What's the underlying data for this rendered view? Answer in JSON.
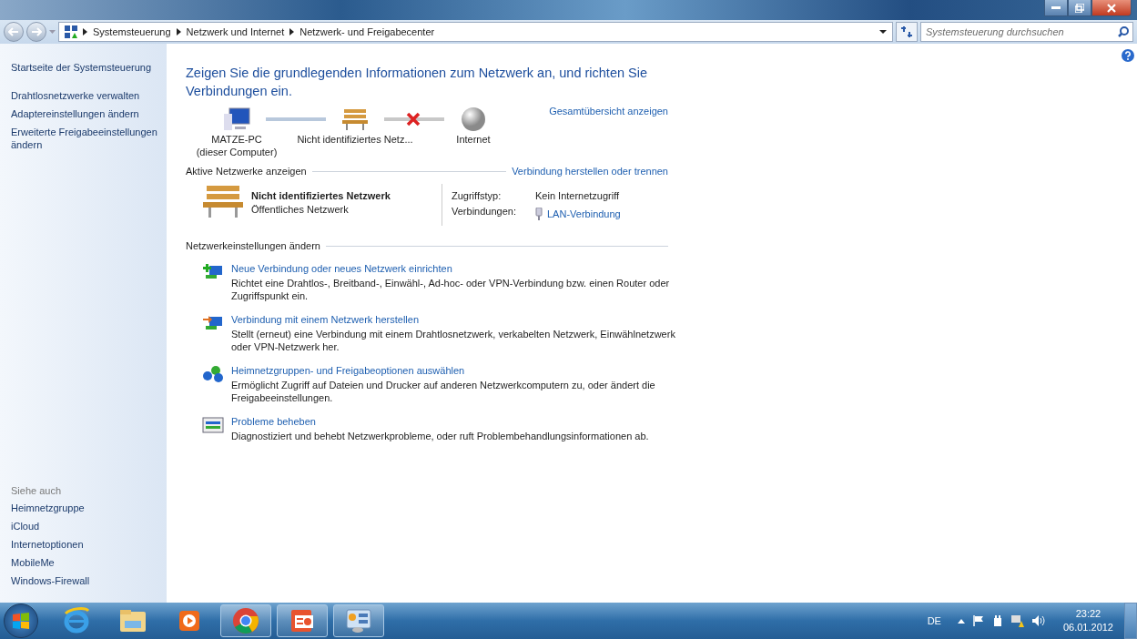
{
  "address_bar": {
    "crumbs": [
      "Systemsteuerung",
      "Netzwerk und Internet",
      "Netzwerk- und Freigabecenter"
    ]
  },
  "search": {
    "placeholder": "Systemsteuerung durchsuchen"
  },
  "sidebar": {
    "home": "Startseite der Systemsteuerung",
    "tasks": [
      "Drahtlosnetzwerke verwalten",
      "Adaptereinstellungen ändern",
      "Erweiterte Freigabeeinstellungen ändern"
    ],
    "see_also_title": "Siehe auch",
    "see_also": [
      "Heimnetzgruppe",
      "iCloud",
      "Internetoptionen",
      "MobileMe",
      "Windows-Firewall"
    ]
  },
  "heading": "Zeigen Sie die grundlegenden Informationen zum Netzwerk an, und richten Sie Verbindungen ein.",
  "map": {
    "nodes": [
      {
        "kind": "computer",
        "label": "MATZE-PC",
        "sublabel": "(dieser Computer)"
      },
      {
        "kind": "bench",
        "label": "Nicht identifiziertes Netz..."
      },
      {
        "kind": "globe",
        "label": "Internet"
      }
    ],
    "links": [
      {
        "broken": false
      },
      {
        "broken": true
      }
    ],
    "overview_link": "Gesamtübersicht anzeigen"
  },
  "active_networks": {
    "title": "Aktive Netzwerke anzeigen",
    "link": "Verbindung herstellen oder trennen",
    "name": "Nicht identifiziertes Netzwerk",
    "category": "Öffentliches Netzwerk",
    "access_label": "Zugriffstyp:",
    "access_value": "Kein Internetzugriff",
    "connections_label": "Verbindungen:",
    "connections_value": "LAN-Verbindung"
  },
  "settings": {
    "title": "Netzwerkeinstellungen ändern",
    "items": [
      {
        "kind": "new",
        "title": "Neue Verbindung oder neues Netzwerk einrichten",
        "description": "Richtet eine Drahtlos-, Breitband-, Einwähl-, Ad-hoc- oder VPN-Verbindung bzw. einen Router oder Zugriffspunkt ein."
      },
      {
        "kind": "connect",
        "title": "Verbindung mit einem Netzwerk herstellen",
        "description": "Stellt (erneut) eine Verbindung mit einem Drahtlosnetzwerk, verkabelten Netzwerk, Einwählnetzwerk oder VPN-Netzwerk her."
      },
      {
        "kind": "homegroup",
        "title": "Heimnetzgruppen- und Freigabeoptionen auswählen",
        "description": "Ermöglicht Zugriff auf Dateien und Drucker auf anderen Netzwerkcomputern zu, oder ändert die Freigabeeinstellungen."
      },
      {
        "kind": "troubleshoot",
        "title": "Probleme beheben",
        "description": "Diagnostiziert und behebt Netzwerkprobleme, oder ruft Problembehandlungsinformationen ab."
      }
    ]
  },
  "taskbar": {
    "apps": [
      {
        "kind": "ie",
        "running": false
      },
      {
        "kind": "explorer",
        "running": false
      },
      {
        "kind": "media",
        "running": false
      },
      {
        "kind": "chrome",
        "running": true
      },
      {
        "kind": "powerpoint",
        "running": true
      },
      {
        "kind": "controlpanel",
        "running": true
      }
    ],
    "language": "DE",
    "time": "23:22",
    "date": "06.01.2012"
  }
}
